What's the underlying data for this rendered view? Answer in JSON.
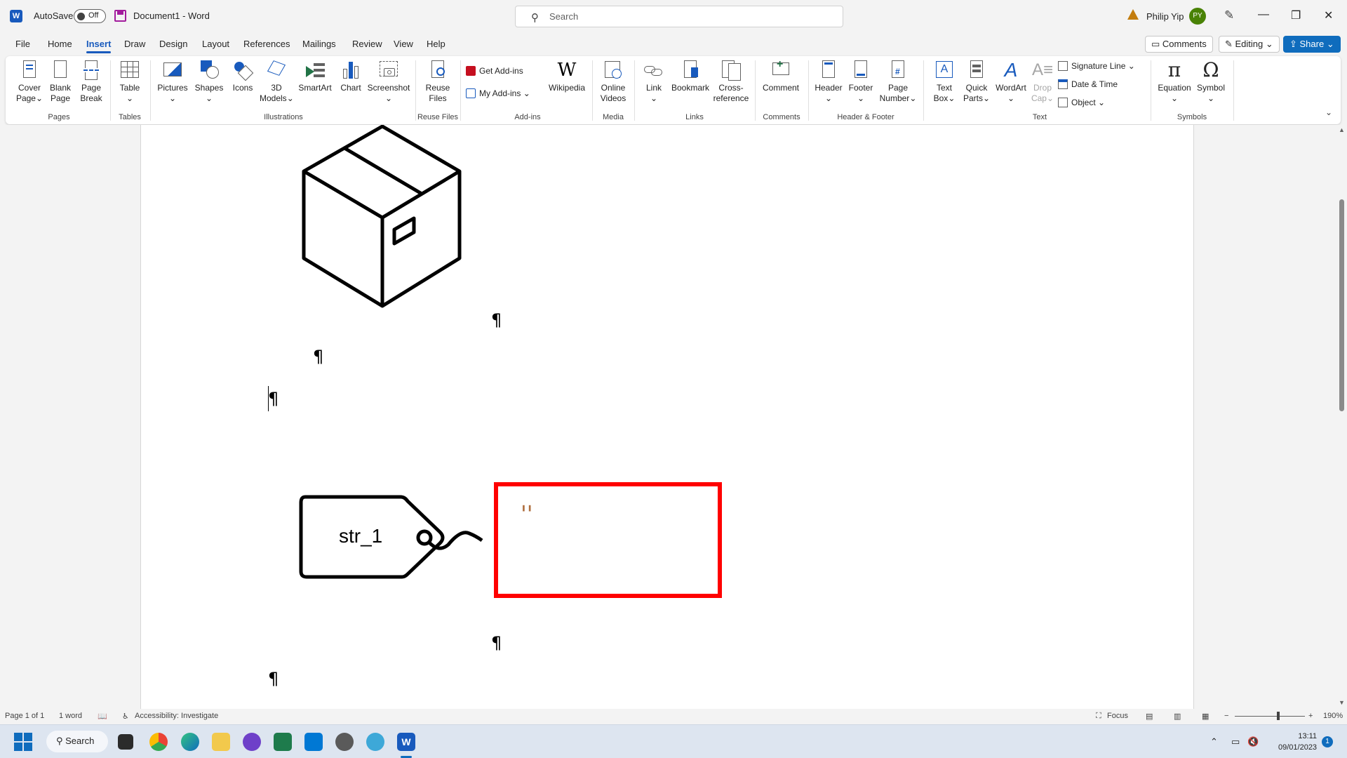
{
  "titlebar": {
    "app_logo": "W",
    "autosave_label": "AutoSave",
    "autosave_state": "Off",
    "document_name": "Document1  -  Word",
    "search_placeholder": "Search",
    "user_name": "Philip Yip",
    "user_initials": "PY",
    "window_controls": [
      "minimize-icon",
      "restore-icon",
      "close-icon"
    ]
  },
  "menu": {
    "tabs": [
      "File",
      "Home",
      "Insert",
      "Draw",
      "Design",
      "Layout",
      "References",
      "Mailings",
      "Review",
      "View",
      "Help"
    ],
    "active_tab": "Insert",
    "comments_label": "Comments",
    "editing_label": "Editing",
    "share_label": "Share"
  },
  "ribbon": {
    "pages": {
      "label": "Pages",
      "cover_page": "Cover\nPage",
      "blank_page": "Blank\nPage",
      "page_break": "Page\nBreak"
    },
    "tables": {
      "label": "Tables",
      "table": "Table"
    },
    "illustrations": {
      "label": "Illustrations",
      "pictures": "Pictures",
      "shapes": "Shapes",
      "icons": "Icons",
      "models_3d": "3D\nModels",
      "smartart": "SmartArt",
      "chart": "Chart",
      "screenshot": "Screenshot"
    },
    "reuse_files": {
      "label": "Reuse Files",
      "reuse_files": "Reuse\nFiles"
    },
    "addins": {
      "label": "Add-ins",
      "get_addins": "Get Add-ins",
      "my_addins": "My Add-ins",
      "wikipedia": "Wikipedia",
      "wiki_glyph": "W"
    },
    "media": {
      "label": "Media",
      "online_videos": "Online\nVideos"
    },
    "links": {
      "label": "Links",
      "link": "Link",
      "bookmark": "Bookmark",
      "cross_reference": "Cross-\nreference"
    },
    "comments": {
      "label": "Comments",
      "comment": "Comment"
    },
    "header_footer": {
      "label": "Header & Footer",
      "header": "Header",
      "footer": "Footer",
      "page_number": "Page\nNumber"
    },
    "text": {
      "label": "Text",
      "text_box": "Text\nBox",
      "quick_parts": "Quick\nParts",
      "wordart": "WordArt",
      "drop_cap": "Drop\nCap",
      "signature_line": "Signature Line",
      "date_time": "Date & Time",
      "object": "Object"
    },
    "symbols": {
      "label": "Symbols",
      "equation": "Equation",
      "symbol": "Symbol",
      "equation_glyph": "π",
      "symbol_glyph": "Ω"
    }
  },
  "document": {
    "pilcrow": "¶",
    "tag_label": "str_1",
    "box_value": "''",
    "box_border_color": "#ff0000",
    "box_value_color": "#b07040"
  },
  "statusbar": {
    "page": "Page 1 of 1",
    "words": "1 word",
    "accessibility": "Accessibility: Investigate",
    "focus": "Focus",
    "zoom": "190%",
    "zoom_in": "+",
    "zoom_out": "−"
  },
  "taskbar": {
    "search_label": "Search",
    "time": "13:11",
    "date": "09/01/2023",
    "notification_count": "1"
  }
}
